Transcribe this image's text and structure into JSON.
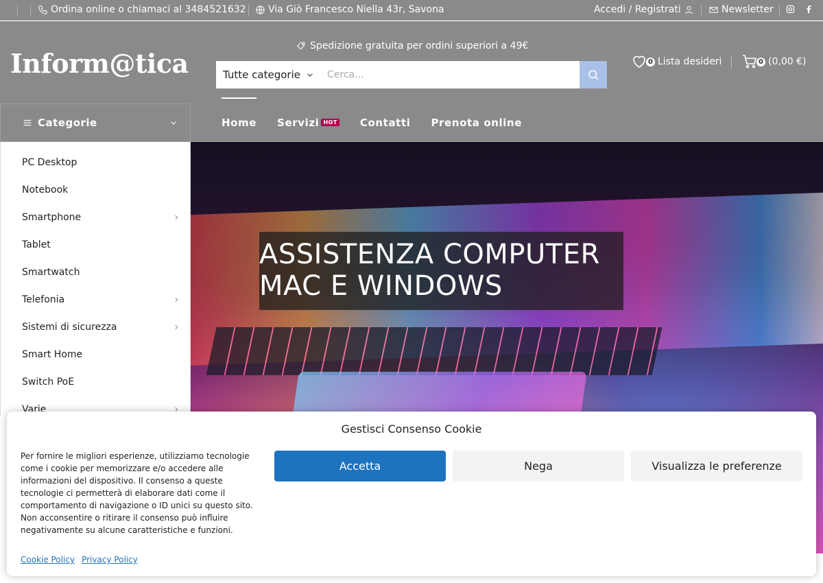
{
  "topbar": {
    "phone_text": "Ordina online o chiamaci al 3484521632",
    "address_text": "Via Giò Francesco Niella 43r, Savona",
    "login_text": "Accedi / Registrati",
    "newsletter_text": "Newsletter"
  },
  "header": {
    "logo": "Inform@tica",
    "promo": "Spedizione gratuita per ordini superiori a 49€",
    "search": {
      "category": "Tutte categorie",
      "placeholder": "Cerca..."
    },
    "wishlist": {
      "count": "0",
      "label": "Lista desideri"
    },
    "cart": {
      "count": "0",
      "total": "(0,00 €)"
    }
  },
  "nav": {
    "categories_label": "Categorie",
    "links": [
      {
        "label": "Home"
      },
      {
        "label": "Servizi",
        "badge": "HOT"
      },
      {
        "label": "Contatti"
      },
      {
        "label": "Prenota online"
      }
    ]
  },
  "sidebar": {
    "items": [
      {
        "label": "PC Desktop",
        "has_children": false
      },
      {
        "label": "Notebook",
        "has_children": false
      },
      {
        "label": "Smartphone",
        "has_children": true
      },
      {
        "label": "Tablet",
        "has_children": false
      },
      {
        "label": "Smartwatch",
        "has_children": false
      },
      {
        "label": "Telefonia",
        "has_children": true
      },
      {
        "label": "Sistemi di sicurezza",
        "has_children": true
      },
      {
        "label": "Smart Home",
        "has_children": false
      },
      {
        "label": "Switch PoE",
        "has_children": false
      },
      {
        "label": "Varie",
        "has_children": true
      }
    ]
  },
  "hero": {
    "line1": "ASSISTENZA COMPUTER",
    "line2": "MAC E WINDOWS"
  },
  "cookie": {
    "title": "Gestisci Consenso Cookie",
    "text": "Per fornire le migliori esperienze, utilizziamo tecnologie come i cookie per memorizzare e/o accedere alle informazioni del dispositivo. Il consenso a queste tecnologie ci permetterà di elaborare dati come il comportamento di navigazione o ID unici su questo sito. Non acconsentire o ritirare il consenso può influire negativamente su alcune caratteristiche e funzioni.",
    "accept": "Accetta",
    "deny": "Nega",
    "prefs": "Visualizza le preferenze",
    "cookie_policy": "Cookie Policy",
    "privacy_policy": "Privacy Policy"
  },
  "colors": {
    "header_bg": "#8a8a8a",
    "accept_btn": "#1e73be",
    "hot_badge": "#b8004f",
    "search_btn": "#a9c1e6"
  }
}
